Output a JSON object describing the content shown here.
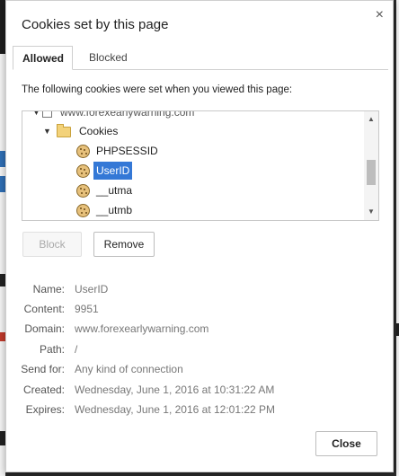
{
  "dialog": {
    "title": "Cookies set by this page",
    "close_glyph": "×"
  },
  "tabs": [
    {
      "label": "Allowed",
      "active": true
    },
    {
      "label": "Blocked",
      "active": false
    }
  ],
  "intro_text": "The following cookies were set when you viewed this page:",
  "tree": {
    "items": [
      {
        "label": "www.forexearlywarning.com",
        "icon": "checkbox-icon"
      },
      {
        "label": "Cookies",
        "icon": "folder-icon"
      },
      {
        "label": "PHPSESSID",
        "icon": "cookie-icon"
      },
      {
        "label": "UserID",
        "icon": "cookie-icon",
        "selected": true
      },
      {
        "label": "__utma",
        "icon": "cookie-icon"
      },
      {
        "label": "__utmb",
        "icon": "cookie-icon"
      }
    ]
  },
  "buttons": {
    "block": "Block",
    "remove": "Remove",
    "close": "Close"
  },
  "details": [
    {
      "label": "Name:",
      "value": "UserID"
    },
    {
      "label": "Content:",
      "value": "9951"
    },
    {
      "label": "Domain:",
      "value": "www.forexearlywarning.com"
    },
    {
      "label": "Path:",
      "value": "/"
    },
    {
      "label": "Send for:",
      "value": "Any kind of connection"
    },
    {
      "label": "Created:",
      "value": "Wednesday, June 1, 2016 at 10:31:22 AM"
    },
    {
      "label": "Expires:",
      "value": "Wednesday, June 1, 2016 at 12:01:22 PM"
    }
  ],
  "colors": {
    "selection": "#3478d6"
  }
}
